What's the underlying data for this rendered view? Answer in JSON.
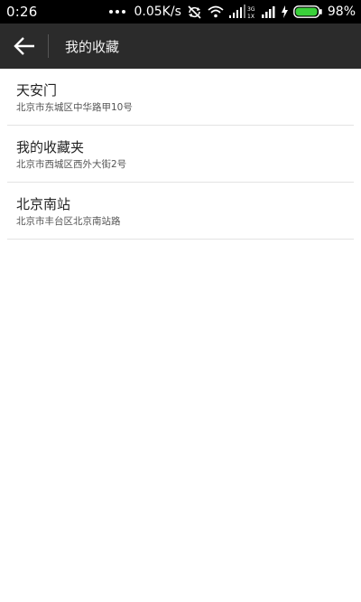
{
  "status_bar": {
    "time": "0:26",
    "net_speed": "0.05K/s",
    "network_type_top": "3G",
    "network_type_bottom": "1X",
    "battery_percent": "98%",
    "battery_level": 0.98,
    "battery_color": "#3ad03a",
    "icons": [
      "more-dots-icon",
      "sync-off-icon",
      "wifi-icon",
      "signal-3g-icon",
      "signal-icon",
      "charging-icon",
      "battery-icon"
    ]
  },
  "title_bar": {
    "back_icon": "arrow-left-icon",
    "title": "我的收藏"
  },
  "favorites": [
    {
      "name": "天安门",
      "address": "北京市东城区中华路甲10号"
    },
    {
      "name": "我的收藏夹",
      "address": "北京市西城区西外大街2号"
    },
    {
      "name": "北京南站",
      "address": "北京市丰台区北京南站路"
    }
  ]
}
